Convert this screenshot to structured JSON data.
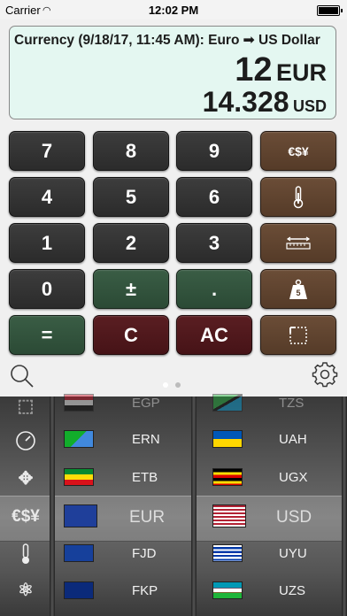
{
  "status": {
    "carrier": "Carrier",
    "time": "12:02 PM"
  },
  "display": {
    "title": "Currency (9/18/17, 11:45 AM): Euro ➟ US Dollar",
    "input_value": "12",
    "input_unit": "EUR",
    "result_value": "14.328",
    "result_unit": "USD"
  },
  "keypad": {
    "k7": "7",
    "k8": "8",
    "k9": "9",
    "currency": "€$¥",
    "k4": "4",
    "k5": "5",
    "k6": "6",
    "k1": "1",
    "k2": "2",
    "k3": "3",
    "k0": "0",
    "plusminus": "±",
    "dot": ".",
    "equals": "=",
    "clear": "C",
    "allclear": "AC"
  },
  "pager": {
    "pages": 2,
    "active": 1
  },
  "picker": {
    "side_currency": "€$¥",
    "left_codes": [
      "EGP",
      "ERN",
      "ETB",
      "EUR",
      "FJD",
      "FKP"
    ],
    "right_codes": [
      "TZS",
      "UAH",
      "UGX",
      "USD",
      "UYU",
      "UZS"
    ],
    "selected_left": "EUR",
    "selected_right": "USD"
  },
  "colors": {
    "display_bg": "#e4f7f1",
    "key_brown": "#5f4330",
    "key_green": "#33533e",
    "key_red": "#511a1d"
  }
}
